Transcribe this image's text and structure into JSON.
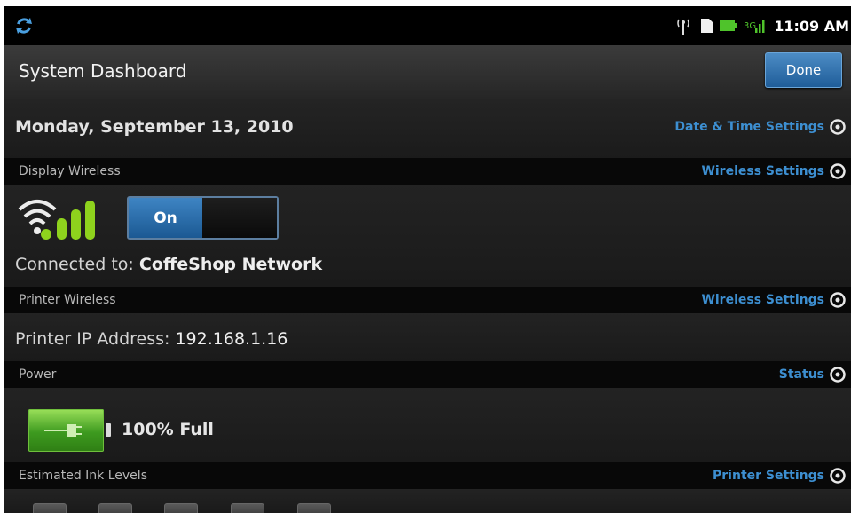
{
  "statusbar": {
    "time": "11:09 AM",
    "icons": [
      "sync-icon",
      "wifi-antenna-icon",
      "sd-card-icon",
      "battery-icon",
      "signal-icon"
    ]
  },
  "titlebar": {
    "title": "System Dashboard",
    "done_label": "Done"
  },
  "date": {
    "text": "Monday, September 13, 2010",
    "link": "Date & Time Settings"
  },
  "display_wireless": {
    "header": "Display Wireless",
    "link": "Wireless Settings",
    "toggle_label": "On",
    "toggle_state": "on",
    "connected_prefix": "Connected to:",
    "network": "CoffeShop Network"
  },
  "printer_wireless": {
    "header": "Printer Wireless",
    "link": "Wireless Settings",
    "ip_prefix": "Printer IP Address:",
    "ip": "192.168.1.16"
  },
  "power": {
    "header": "Power",
    "link": "Status",
    "level_text": "100% Full",
    "level": 1.0
  },
  "ink": {
    "header": "Estimated Ink Levels",
    "link": "Printer Settings"
  },
  "colors": {
    "accent_blue": "#3d8fd1",
    "battery_green": "#4caf24",
    "wifi_green": "#8ed21d"
  }
}
